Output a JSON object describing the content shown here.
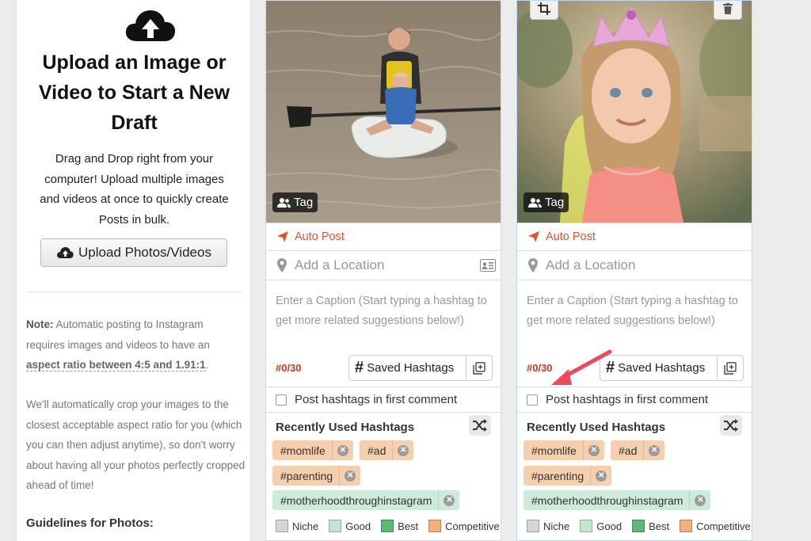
{
  "upload": {
    "title": "Upload an Image or Video to Start a New Draft",
    "description": "Drag and Drop right from your computer! Upload multiple images and videos at once to quickly create Posts in bulk.",
    "button_label": "Upload Photos/Videos",
    "note_label": "Note:",
    "note_text": " Automatic posting to Instagram requires images and videos to have an ",
    "note_ratio": "aspect ratio between 4:5 and 1.91:1",
    "note_end": ".",
    "crop_text": "We'll automatically crop your images to the closest acceptable aspect ratio for you (which you can then adjust anytime), so don't worry about having all your photos perfectly cropped ahead of time!",
    "guidelines_heading": "Guidelines for Photos:"
  },
  "cards": [
    {
      "tag_label": "Tag",
      "auto_post": "Auto Post",
      "location_placeholder": "Add a Location",
      "caption_placeholder": "Enter a Caption (Start typing a hashtag to get more related suggestions below!)",
      "hashtag_count": "#0/30",
      "saved_hashtags": "Saved Hashtags",
      "first_comment_label": "Post hashtags in first comment",
      "recent_heading": "Recently Used Hashtags",
      "hashtags": [
        "#momlife",
        "#ad",
        "#parenting",
        "#motherhoodthroughinstagram"
      ]
    },
    {
      "tag_label": "Tag",
      "auto_post": "Auto Post",
      "location_placeholder": "Add a Location",
      "caption_placeholder": "Enter a Caption (Start typing a hashtag to get more related suggestions below!)",
      "hashtag_count": "#0/30",
      "saved_hashtags": "Saved Hashtags",
      "first_comment_label": "Post hashtags in first comment",
      "recent_heading": "Recently Used Hashtags",
      "hashtags": [
        "#momlife",
        "#ad",
        "#parenting",
        "#motherhoodthroughinstagram"
      ]
    }
  ],
  "legend": [
    "Niche",
    "Good",
    "Best",
    "Competitive"
  ],
  "colors": {
    "accent": "#e0512f",
    "count_red": "#c0392b",
    "niche": "#d6d6d6",
    "good": "#c4e6cf",
    "best": "#5cb874",
    "competitive": "#f2b07c",
    "chip_competitive": "#f6cfae",
    "chip_good": "#cdebd9",
    "annotation_arrow": "#ef4a5a"
  },
  "icons": {
    "upload": "cloud-upload-icon",
    "tag": "people-tag-icon",
    "auto_post": "paper-plane-icon",
    "location": "map-pin-icon",
    "location_card": "id-card-icon",
    "saved": "hash-icon",
    "add_saved": "plus-square-icon",
    "shuffle": "shuffle-icon",
    "crop": "crop-icon",
    "trash": "trash-icon"
  }
}
